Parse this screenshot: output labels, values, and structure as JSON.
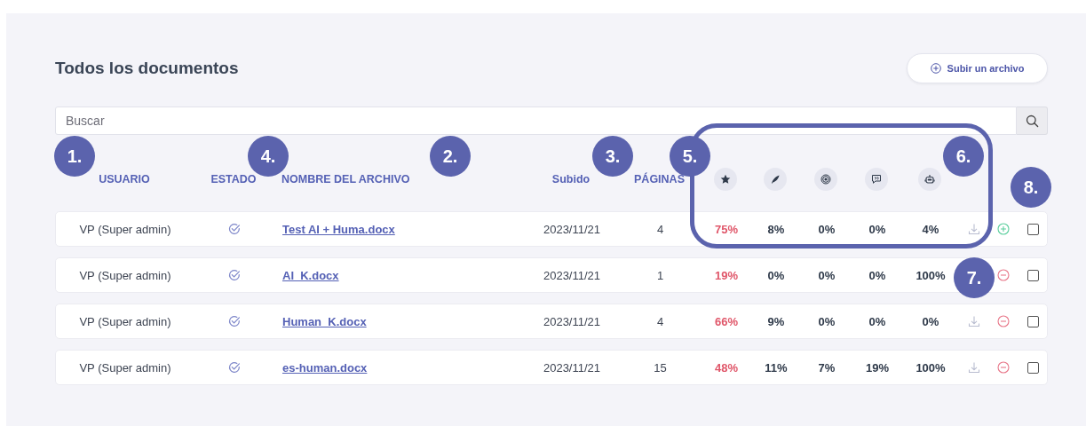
{
  "title": "Todos los documentos",
  "upload_button": {
    "label": "Subir un archivo"
  },
  "search": {
    "placeholder": "Buscar"
  },
  "columns": [
    "USUARIO",
    "ESTADO",
    "NOMBRE DEL ARCHIVO",
    "Subido",
    "PÁGINAS"
  ],
  "rows": [
    {
      "user": "VP (Super admin)",
      "file": "Test AI + Huma.docx",
      "uploaded": "2023/11/21",
      "pages": "4",
      "scores": [
        "75%",
        "8%",
        "0%",
        "0%",
        "4%"
      ],
      "download": true,
      "kind": "add",
      "checked": false
    },
    {
      "user": "VP (Super admin)",
      "file": "AI_K.docx",
      "uploaded": "2023/11/21",
      "pages": "1",
      "scores": [
        "19%",
        "0%",
        "0%",
        "0%",
        "100%"
      ],
      "download": false,
      "kind": "remove",
      "checked": false
    },
    {
      "user": "VP (Super admin)",
      "file": "Human_K.docx",
      "uploaded": "2023/11/21",
      "pages": "4",
      "scores": [
        "66%",
        "9%",
        "0%",
        "0%",
        "0%"
      ],
      "download": true,
      "kind": "remove",
      "checked": false
    },
    {
      "user": "VP (Super admin)",
      "file": "es-human.docx",
      "uploaded": "2023/11/21",
      "pages": "15",
      "scores": [
        "48%",
        "11%",
        "7%",
        "19%",
        "100%"
      ],
      "download": true,
      "kind": "remove",
      "checked": false
    }
  ],
  "annotations": [
    {
      "label": "1."
    },
    {
      "label": "4."
    },
    {
      "label": "2."
    },
    {
      "label": "3."
    },
    {
      "label": "5."
    },
    {
      "label": "6."
    },
    {
      "label": "8."
    },
    {
      "label": "7."
    }
  ]
}
